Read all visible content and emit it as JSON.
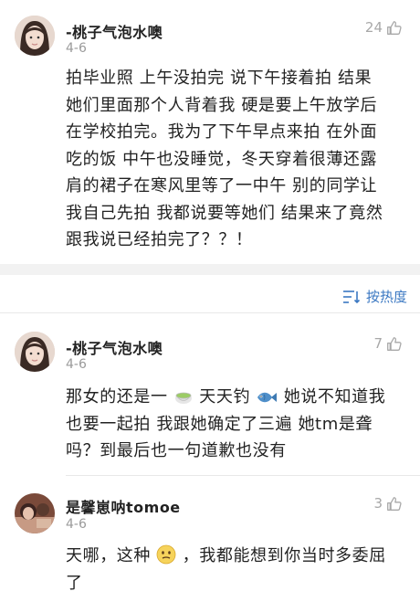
{
  "main_post": {
    "username": "-桃子气泡水噢",
    "date": "4-6",
    "likes": "24",
    "lines": [
      "拍毕业照 上午没拍完 说下午接着拍 结果",
      "她们里面那个人背着我 硬是要上午放学后",
      "在学校拍完。我为了下午早点来拍 在外面",
      "吃的饭 中午也没睡觉，冬天穿着很薄还露",
      "肩的裙子在寒风里等了一中午 别的同学让",
      "我自己先拍 我都说要等她们 结果来了竟然",
      "跟我说已经拍完了？？！"
    ]
  },
  "sort": {
    "label": "按热度"
  },
  "replies": [
    {
      "username": "-桃子气泡水噢",
      "date": "4-6",
      "likes": "7",
      "line1_a": "那女的还是一",
      "line1_b": " 天天钓",
      "line1_c": " 她说不知道我",
      "line2": "也要一起拍 我跟她确定了三遍 她tm是聋",
      "line3": "吗？到最后也一句道歉也没有"
    },
    {
      "username": "是馨崽呐tomoe",
      "date": "4-6",
      "likes": "3",
      "line1_a": "天哪，这种",
      "line1_b": "，我都能想到你当时多委屈",
      "line2": "了"
    }
  ],
  "colors": {
    "accent": "#3b78c2",
    "muted": "#9a9a9a",
    "band": "#f2f2f2"
  }
}
